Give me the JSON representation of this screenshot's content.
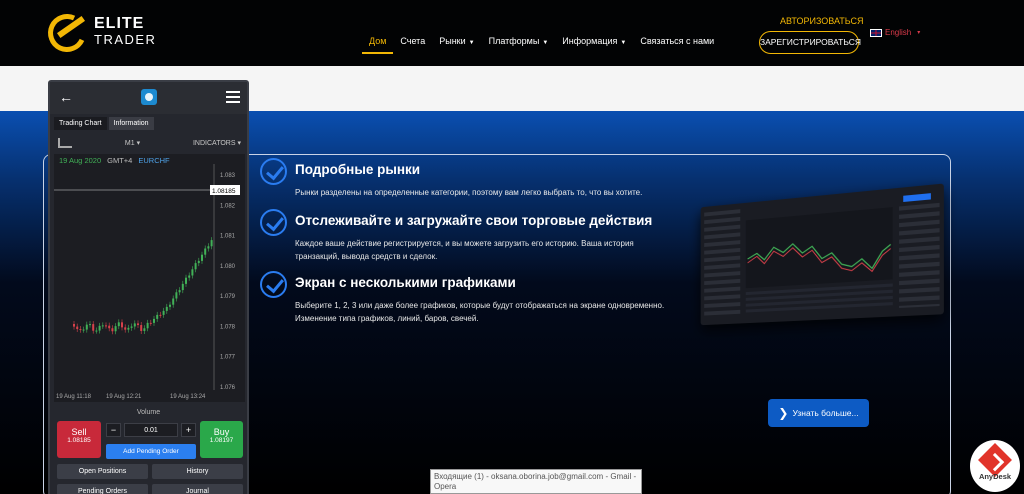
{
  "header": {
    "logo": {
      "line1": "ELITE",
      "line2": "TRADER"
    },
    "nav": [
      {
        "label": "Дом",
        "active": true,
        "dropdown": false
      },
      {
        "label": "Счета",
        "active": false,
        "dropdown": false
      },
      {
        "label": "Рынки",
        "active": false,
        "dropdown": true
      },
      {
        "label": "Платформы",
        "active": false,
        "dropdown": true
      },
      {
        "label": "Информация",
        "active": false,
        "dropdown": true
      },
      {
        "label": "Связаться с нами",
        "active": false,
        "dropdown": false
      }
    ],
    "login_label": "АВТОРИЗОВАТЬСЯ",
    "register_label": "ЗАРЕГИСТРИРОВАТЬСЯ",
    "language": "English",
    "accent_color": "#f2b705"
  },
  "features": [
    {
      "title": "Подробные рынки",
      "text": "Рынки разделены на определенные категории, поэтому вам легко выбрать то, что вы хотите."
    },
    {
      "title": "Отслеживайте и загружайте свои торговые действия",
      "text": "Каждое ваше действие регистрируется, и вы можете загрузить его историю. Ваша история транзакций, вывода средств и сделок."
    },
    {
      "title": "Экран с несколькими графиками",
      "text": "Выберите 1, 2, 3 или даже более графиков, которые будут отображаться на экране одновременно. Изменение типа графиков, линий, баров, свечей."
    }
  ],
  "learn_more_label": "Узнать больше...",
  "phone": {
    "tabs": [
      "Trading Chart",
      "Information"
    ],
    "timeframe": "M1",
    "indicators_label": "INDICATORS",
    "chart": {
      "date": "19 Aug 2020",
      "timezone": "GMT+4",
      "symbol": "EURCHF",
      "current_price": "1.08185",
      "price_ticks": [
        "1.083",
        "1.082",
        "1.081",
        "1.080",
        "1.079",
        "1.078",
        "1.077",
        "1.076"
      ],
      "time_ticks": [
        "19 Aug 11:18",
        "19 Aug 12:21",
        "19 Aug 13:24"
      ]
    },
    "volume_label": "Volume",
    "volume_value": "0.01",
    "sell": {
      "label": "Sell",
      "price": "1.08185"
    },
    "buy": {
      "label": "Buy",
      "price": "1.08197"
    },
    "pending_label": "Add Pending Order",
    "open_positions_label": "Open Positions",
    "history_label": "History",
    "pending_orders_label": "Pending Orders",
    "journal_label": "Journal"
  },
  "tooltip": "Входящие (1) - oksana.oborina.job@gmail.com - Gmail - Opera",
  "anydesk_label": "AnyDesk"
}
